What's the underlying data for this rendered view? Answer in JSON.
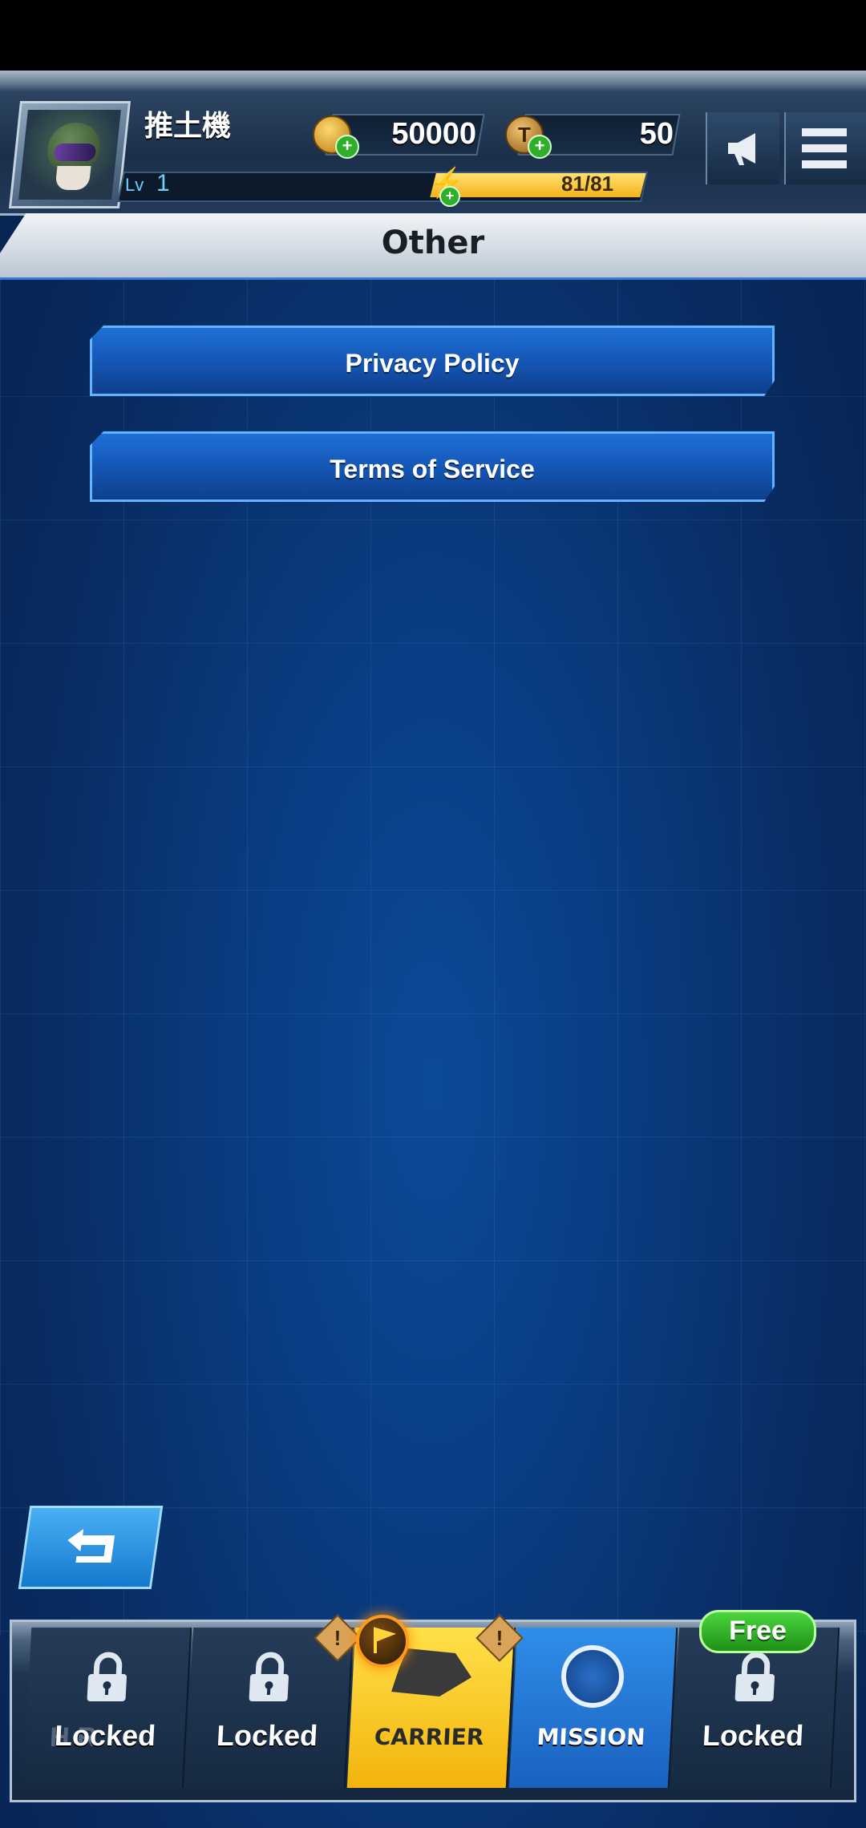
{
  "hud": {
    "player_name": "推土機",
    "level_label": "Lv",
    "level_value": "1",
    "gold_amount": "50000",
    "ticket_amount": "50",
    "ticket_icon_letter": "T",
    "energy_text": "81/81",
    "energy_fill": 1.0,
    "plus_sign": "+",
    "icons": {
      "gold": "gold-coin-icon",
      "ticket": "ticket-token-icon",
      "energy": "lightning-bolt-icon",
      "announce": "megaphone-icon",
      "menu": "hamburger-menu-icon"
    }
  },
  "page": {
    "title": "Other"
  },
  "menu": {
    "items": [
      {
        "label": "Privacy Policy"
      },
      {
        "label": "Terms of Service"
      }
    ]
  },
  "back_button": {
    "icon": "back-arrow-icon"
  },
  "bottom_nav": {
    "slots": [
      {
        "label": "Locked",
        "ghost_label": "H R",
        "icon": "lock-icon"
      },
      {
        "label": "Locked",
        "icon": "lock-icon"
      },
      {
        "label": "CARRIER",
        "icon": "carrier-ship-icon",
        "badge_icon": "flag-icon",
        "active": true
      },
      {
        "label": "MISSION",
        "icon": "radar-icon"
      },
      {
        "label": "Locked",
        "icon": "lock-icon",
        "badge_text": "Free"
      }
    ],
    "warn_mark": "!"
  },
  "colors": {
    "background": "#0a2f6b",
    "accent_blue": "#1f6fd6",
    "carrier_yellow": "#ffe04a",
    "free_green": "#4bd63f",
    "energy_yellow": "#f5b31b"
  }
}
